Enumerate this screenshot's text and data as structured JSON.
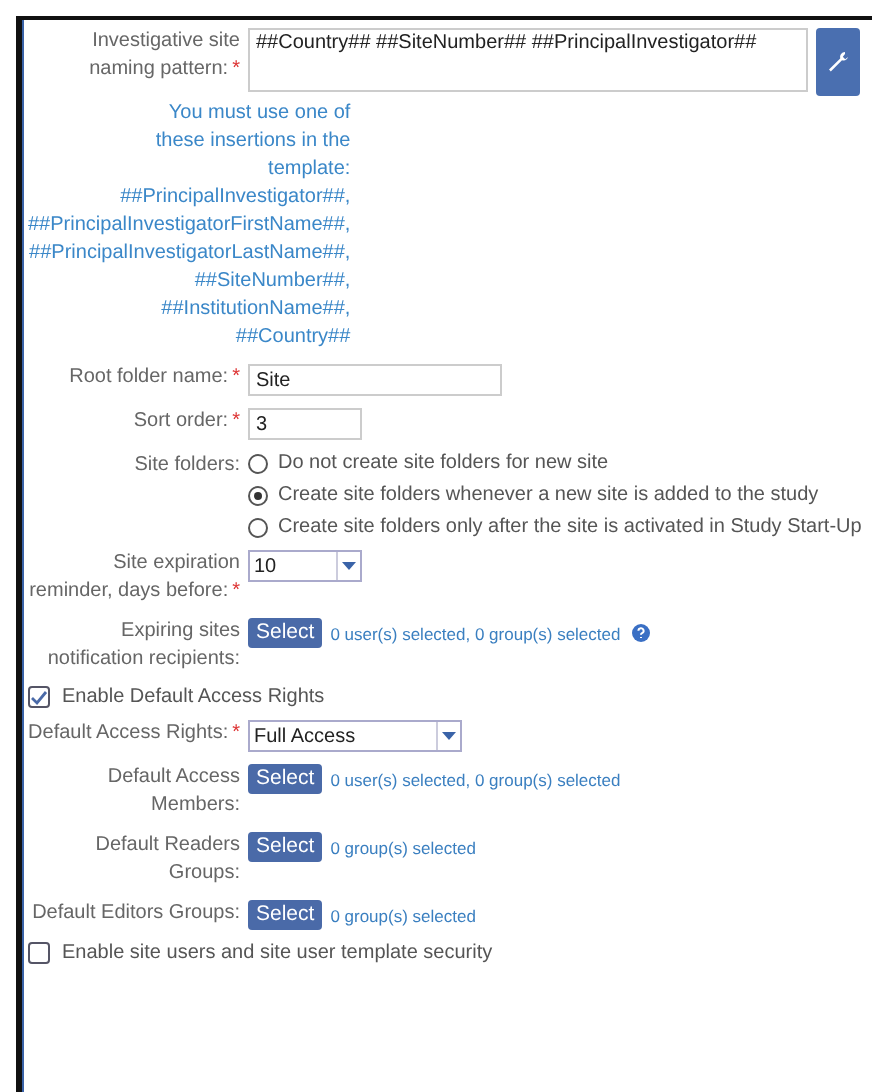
{
  "naming_pattern": {
    "label": "Investigative site naming pattern:",
    "required_mark": "*",
    "value": "##Country## ##SiteNumber## ##PrincipalInvestigator##"
  },
  "hint": "You must use one of\nthese insertions in the\ntemplate:\n##PrincipalInvestigator##,\n##PrincipalInvestigatorFirstName##,\n##PrincipalInvestigatorLastName##,\n##SiteNumber##,\n##InstitutionName##,\n##Country##",
  "root_folder": {
    "label": "Root folder name:",
    "required_mark": "*",
    "value": "Site"
  },
  "sort_order": {
    "label": "Sort order:",
    "required_mark": "*",
    "value": "3"
  },
  "site_folders": {
    "label": "Site folders:",
    "options": [
      {
        "label": "Do not create site folders for new site",
        "selected": false
      },
      {
        "label": "Create site folders whenever a new site is added to the study",
        "selected": true
      },
      {
        "label": "Create site folders only after the site is activated in Study Start-Up",
        "selected": false
      }
    ]
  },
  "expiration": {
    "label": "Site expiration reminder, days before:",
    "required_mark": "*",
    "value": "10"
  },
  "recipients": {
    "label": "Expiring sites notification recipients:",
    "button": "Select",
    "summary": "0 user(s) selected, 0 group(s) selected"
  },
  "enable_default_access": {
    "label": "Enable Default Access Rights",
    "checked": true
  },
  "access_rights": {
    "label": "Default Access Rights:",
    "required_mark": "*",
    "value": "Full Access"
  },
  "pickers": [
    {
      "label": "Default Access Members:",
      "button": "Select",
      "summary": "0 user(s) selected, 0 group(s) selected"
    },
    {
      "label": "Default Readers Groups:",
      "button": "Select",
      "summary": "0 group(s) selected"
    },
    {
      "label": "Default Editors Groups:",
      "button": "Select",
      "summary": "0 group(s) selected"
    }
  ],
  "enable_site_users": {
    "label": "Enable site users and site user template security",
    "checked": false
  }
}
